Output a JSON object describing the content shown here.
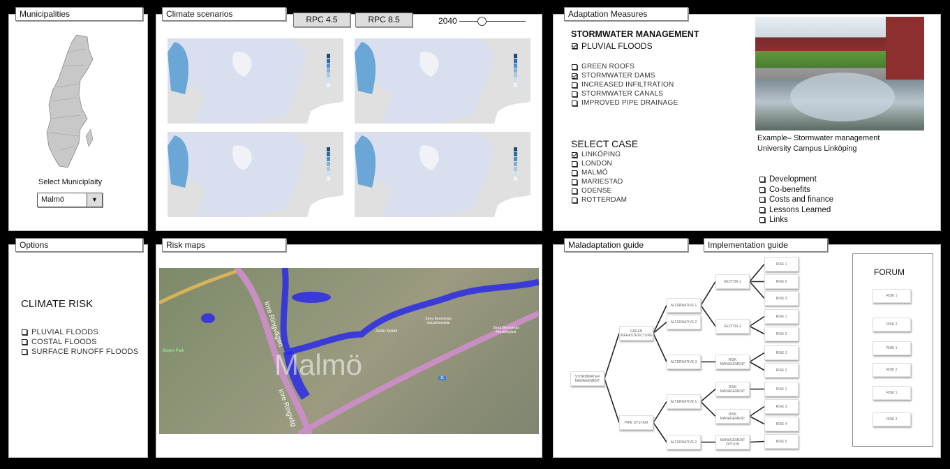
{
  "municipalities": {
    "title": "Municipalities",
    "select_label": "Select Municiplaity",
    "selected": "Malmö",
    "dropdown_icon": "triangle-down"
  },
  "climate": {
    "title": "Climate scenarios",
    "buttons": [
      "RPC 4.5",
      "RPC 8.5"
    ],
    "year": "2040",
    "slider_value": 2040
  },
  "adaptation": {
    "title": "Adaptation Measures",
    "heading": "STORMWATER MANAGEMENT",
    "main_check": {
      "label": "PLUVIAL FLOODS",
      "checked": true
    },
    "measures": [
      {
        "label": "GREEN ROOFS",
        "checked": false
      },
      {
        "label": "STORMWATER DAMS",
        "checked": true
      },
      {
        "label": "INCREASED INFILTRATION",
        "checked": false
      },
      {
        "label": "STORMWATER CANALS",
        "checked": false
      },
      {
        "label": "IMPROVED PIPE DRAINAGE",
        "checked": false
      }
    ],
    "case_heading": "SELECT CASE",
    "cases": [
      {
        "label": "LINKÖPING",
        "checked": true
      },
      {
        "label": "LONDON",
        "checked": false
      },
      {
        "label": "MALMÖ",
        "checked": false
      },
      {
        "label": "MARIESTAD",
        "checked": false
      },
      {
        "label": "ODENSE",
        "checked": false
      },
      {
        "label": "ROTTERDAM",
        "checked": false
      }
    ],
    "caption_line1": "Example– Stormwater management",
    "caption_line2": "University Campus Linköping",
    "info": [
      {
        "label": "Development",
        "checked": false
      },
      {
        "label": "Co-benefits",
        "checked": false
      },
      {
        "label": "Costs and finance",
        "checked": false
      },
      {
        "label": "Lessons Learned",
        "checked": false
      },
      {
        "label": "Links",
        "checked": false
      }
    ]
  },
  "options": {
    "title": "Options",
    "heading": "CLIMATE RISK",
    "items": [
      {
        "label": "PLUVIAL FLOODS",
        "checked": false
      },
      {
        "label": "COSTAL FLOODS",
        "checked": false
      },
      {
        "label": "SURFACE RUNOFF FLOODS",
        "checked": false
      }
    ]
  },
  "risk_maps": {
    "title": "Risk maps",
    "city_label": "Malmö",
    "road_label_1": "Inre Ringvägen",
    "road_label_2": "Inre Ringväg",
    "park_label": "Bejers Park",
    "area_1": "Addo Nobel",
    "area_2": "Stora Bernstorps industriområde",
    "area_3": "Stora Bernstorps Handelsplats",
    "route_badge": "11",
    "flood_color": "#2a2ae8"
  },
  "guides": {
    "tab1": "Maladaptation guide",
    "tab2": "Implementation guide",
    "tree": [
      {
        "id": "root",
        "label": "STORMWATER MANAGEMENT",
        "parent": null
      },
      {
        "id": "gi",
        "label": "GREEN INFRASTRUCTURE",
        "parent": "root"
      },
      {
        "id": "pipe",
        "label": "PIPE SYSTEM",
        "parent": "root"
      },
      {
        "id": "a1",
        "label": "ALTERNATIVE 1",
        "parent": "gi"
      },
      {
        "id": "a2",
        "label": "ALTERNATIVE 2",
        "parent": "gi"
      },
      {
        "id": "a3",
        "label": "ALTERNATIVE 3",
        "parent": "gi"
      },
      {
        "id": "b1",
        "label": "ALTERNATIVE 1",
        "parent": "pipe"
      },
      {
        "id": "b2",
        "label": "ALTERNATIVE 2",
        "parent": "pipe"
      },
      {
        "id": "s1",
        "label": "SECTOR 1",
        "parent": "a1"
      },
      {
        "id": "s2",
        "label": "SECTOR 2",
        "parent": "a1"
      },
      {
        "id": "m1",
        "label": "RISK MANAGEMENT",
        "parent": "a3"
      },
      {
        "id": "m2",
        "label": "RISK MANAGEMENT",
        "parent": "b1"
      },
      {
        "id": "m3",
        "label": "RISK MANAGEMENT",
        "parent": "b1"
      },
      {
        "id": "m4",
        "label": "MANAGEMENT OPTION",
        "parent": "b2"
      },
      {
        "id": "r1",
        "label": "RISK 1",
        "parent": "s1"
      },
      {
        "id": "r2",
        "label": "RISK 2",
        "parent": "s1"
      },
      {
        "id": "r3",
        "label": "RISK 3",
        "parent": "s1"
      },
      {
        "id": "r4",
        "label": "RISK 1",
        "parent": "s2"
      },
      {
        "id": "r5",
        "label": "RISK 2",
        "parent": "s2"
      },
      {
        "id": "r6",
        "label": "RISK 1",
        "parent": "m1"
      },
      {
        "id": "r7",
        "label": "RISK 2",
        "parent": "m1"
      },
      {
        "id": "r8",
        "label": "RISK 1",
        "parent": "m2"
      },
      {
        "id": "r9",
        "label": "RISK 3",
        "parent": "m3"
      },
      {
        "id": "r10",
        "label": "RISK 4",
        "parent": "m3"
      },
      {
        "id": "r11",
        "label": "RISK 5",
        "parent": "m4"
      }
    ],
    "forum": {
      "title": "FORUM",
      "items": [
        "RISK 1",
        "RISK 2",
        "RISK 1",
        "RISK 2",
        "RISK 1",
        "RISK 2"
      ]
    }
  }
}
